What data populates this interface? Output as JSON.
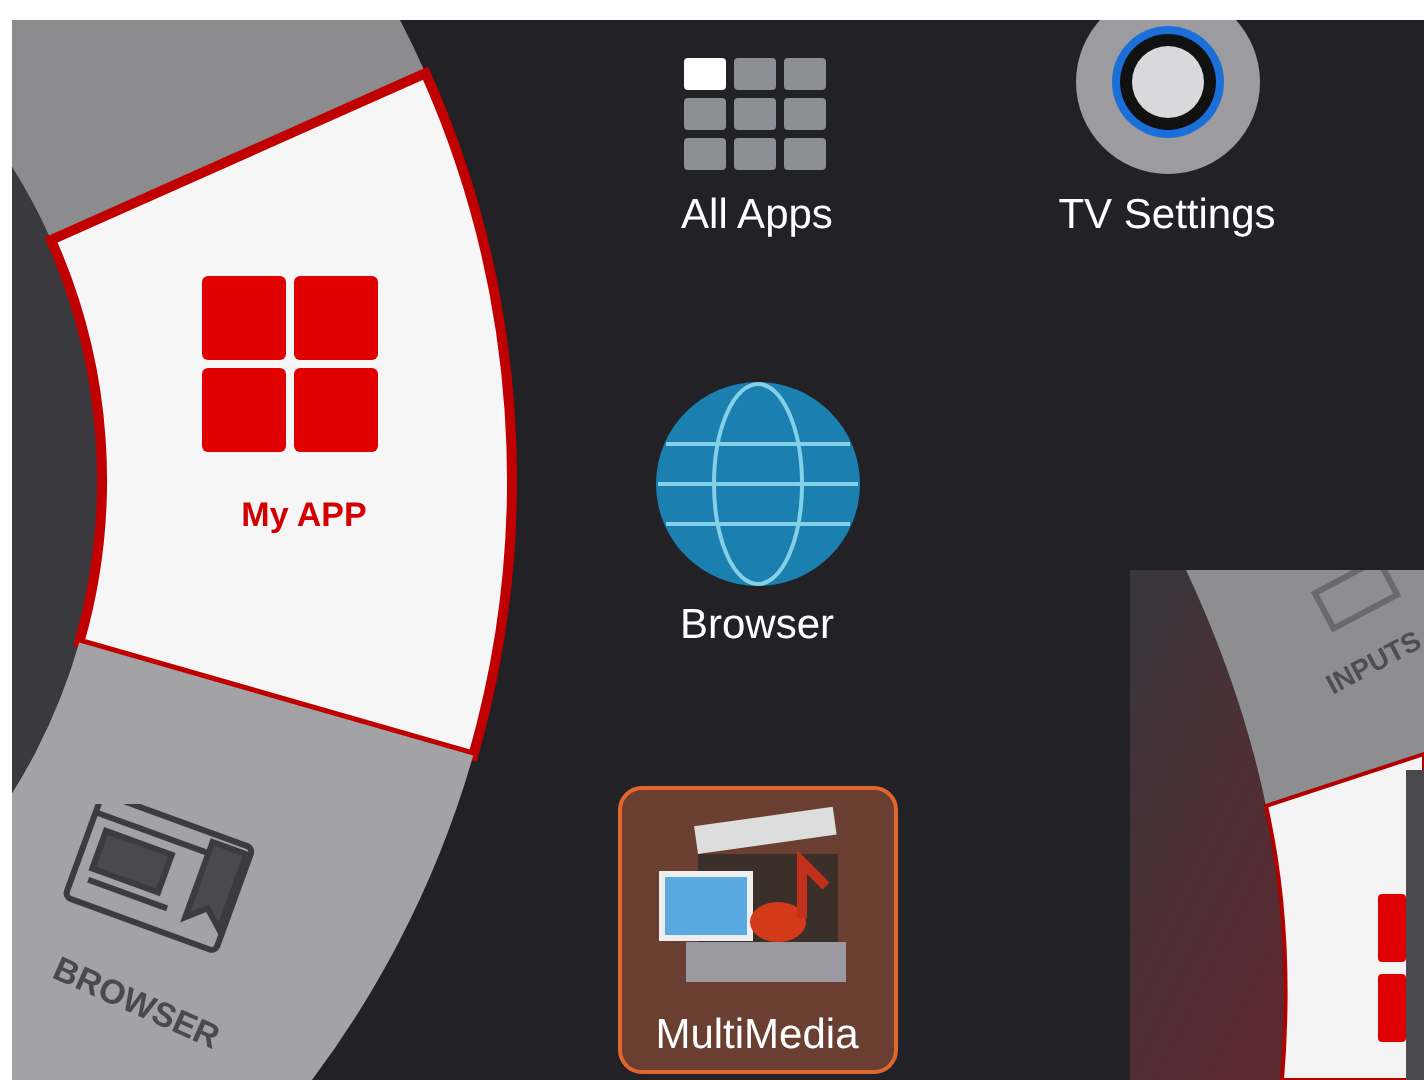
{
  "left_wheel": {
    "items": [
      {
        "label": "My APP",
        "kind": "apps",
        "selected": true
      },
      {
        "label": "BROWSER",
        "kind": "browser",
        "selected": false
      }
    ]
  },
  "apps": [
    [
      {
        "label": "All Apps",
        "kind": "all-apps",
        "focused": false
      },
      {
        "label": "TV Settings",
        "kind": "settings",
        "focused": false
      }
    ],
    [
      {
        "label": "Browser",
        "kind": "globe",
        "focused": false
      }
    ],
    [
      {
        "label": "MultiMedia",
        "kind": "media",
        "focused": true
      }
    ]
  ],
  "right_wheel": {
    "items": [
      {
        "label": "INPUTS",
        "kind": "inputs",
        "selected": false
      },
      {
        "kind": "apps",
        "selected": true
      }
    ]
  }
}
